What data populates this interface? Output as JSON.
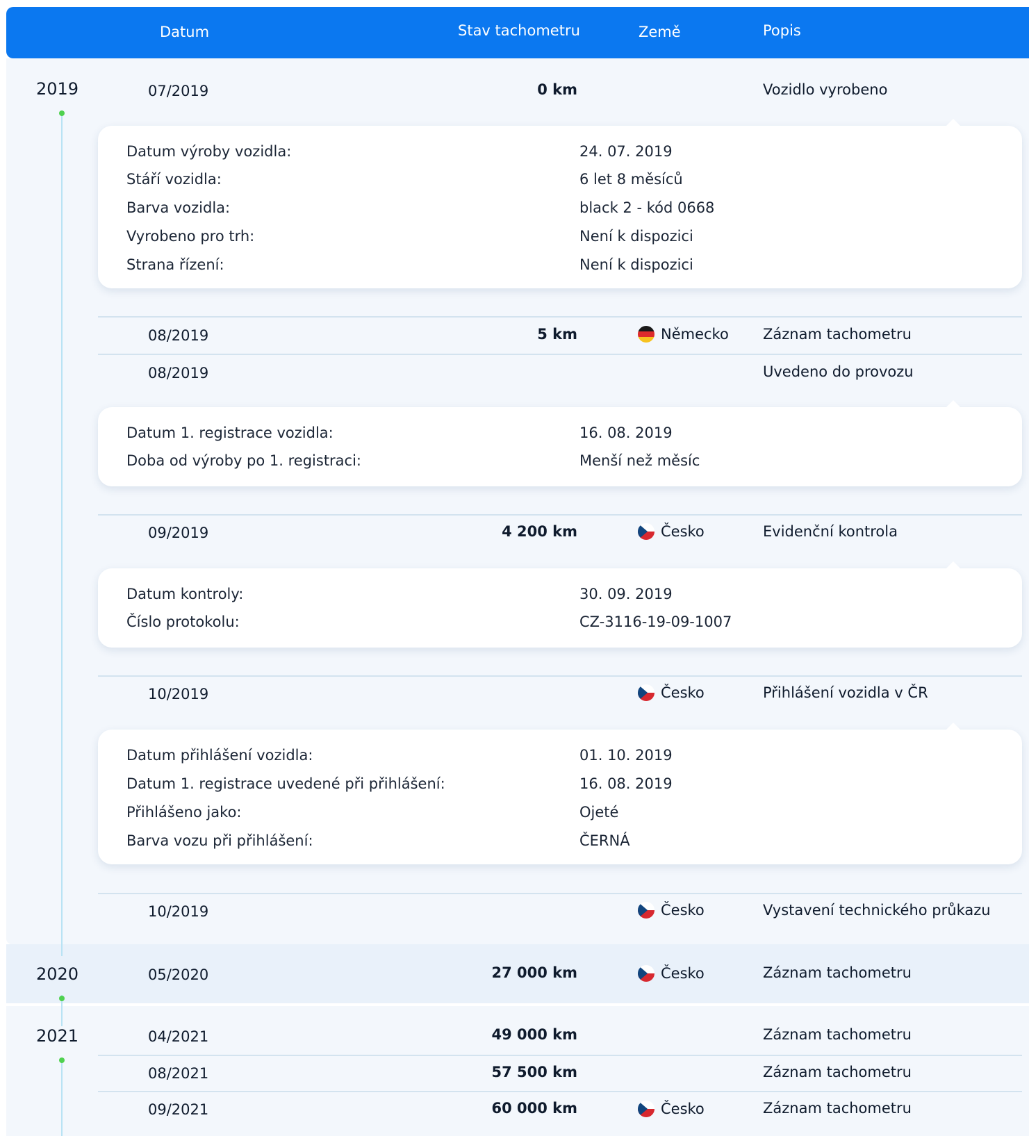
{
  "header": {
    "col_date": "Datum",
    "col_km": "Stav tachometru",
    "col_country": "Země",
    "col_desc": "Popis"
  },
  "years": [
    "2019",
    "2020",
    "2021"
  ],
  "events": [
    {
      "date": "07/2019",
      "km": "0 km",
      "country": "",
      "description": "Vozidlo vyrobeno"
    },
    {
      "date": "08/2019",
      "km": "5 km",
      "country": "Německo",
      "description": "Záznam tachometru"
    },
    {
      "date": "08/2019",
      "km": "",
      "country": "",
      "description": "Uvedeno do provozu"
    },
    {
      "date": "09/2019",
      "km": "4 200 km",
      "country": "Česko",
      "description": "Evidenční kontrola"
    },
    {
      "date": "10/2019",
      "km": "",
      "country": "Česko",
      "description": "Přihlášení vozidla v ČR"
    },
    {
      "date": "10/2019",
      "km": "",
      "country": "Česko",
      "description": "Vystavení technického průkazu"
    },
    {
      "date": "05/2020",
      "km": "27 000 km",
      "country": "Česko",
      "description": "Záznam tachometru"
    },
    {
      "date": "04/2021",
      "km": "49 000 km",
      "country": "",
      "description": "Záznam tachometru"
    },
    {
      "date": "08/2021",
      "km": "57 500 km",
      "country": "",
      "description": "Záznam tachometru"
    },
    {
      "date": "09/2021",
      "km": "60 000 km",
      "country": "Česko",
      "description": "Záznam tachometru"
    }
  ],
  "details": {
    "production": [
      {
        "label": "Datum výroby vozidla:",
        "value": "24. 07. 2019"
      },
      {
        "label": "Stáří vozidla:",
        "value": "6 let 8 měsíců"
      },
      {
        "label": "Barva vozidla:",
        "value": "black 2 - kód 0668"
      },
      {
        "label": "Vyrobeno pro trh:",
        "value": "Není k dispozici"
      },
      {
        "label": "Strana řízení:",
        "value": "Není k dispozici"
      }
    ],
    "registration": [
      {
        "label": "Datum 1. registrace vozidla:",
        "value": "16. 08. 2019"
      },
      {
        "label": "Doba od výroby po 1. registraci:",
        "value": "Menší než měsíc"
      }
    ],
    "inspection": [
      {
        "label": "Datum kontroly:",
        "value": "30. 09. 2019"
      },
      {
        "label": "Číslo protokolu:",
        "value": "CZ-3116-19-09-1007"
      }
    ],
    "cz_registration": [
      {
        "label": "Datum přihlášení vozidla:",
        "value": "01. 10. 2019"
      },
      {
        "label": "Datum 1. registrace uvedené při přihlášení:",
        "value": "16. 08. 2019"
      },
      {
        "label": "Přihlášeno jako:",
        "value": "Ojeté"
      },
      {
        "label": "Barva vozu při přihlášení:",
        "value": "ČERNÁ"
      }
    ]
  },
  "flags": {
    "Německo": "flag-de",
    "Česko": "flag-cz"
  },
  "colors": {
    "header": "#0b78f0",
    "timeline_dot": "#4fd14f",
    "background": "#f3f7fc"
  }
}
